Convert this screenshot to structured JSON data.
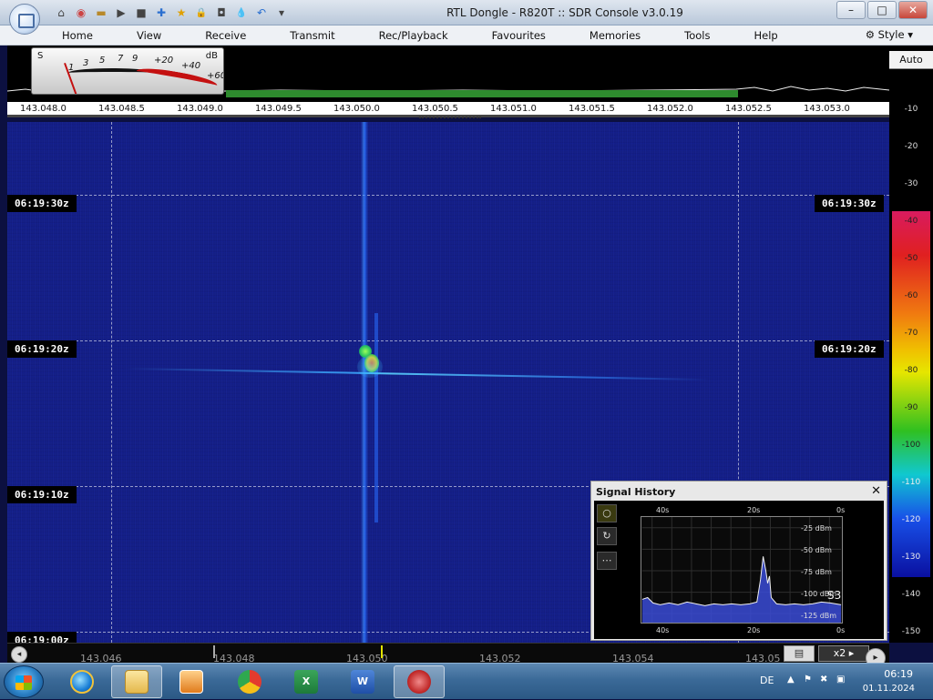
{
  "window": {
    "title": "RTL Dongle - R820T :: SDR Console v3.0.19",
    "minimize_label": "–",
    "maximize_label": "□",
    "close_label": "✕"
  },
  "quick_access": {
    "icons": [
      "home-icon",
      "lifebuoy-icon",
      "folder-icon",
      "play-icon",
      "stop-icon",
      "add-icon",
      "star-icon",
      "lock-icon",
      "camera-icon",
      "drop-icon",
      "undo-icon",
      "dropdown-icon"
    ],
    "glyphs": [
      "⌂",
      "◉",
      "▬",
      "▶",
      "■",
      "✚",
      "★",
      "🔒",
      "◘",
      "💧",
      "↶",
      "▾"
    ]
  },
  "menu": {
    "items": [
      "Home",
      "View",
      "Receive",
      "Transmit",
      "Rec/Playback",
      "Favourites",
      "Memories",
      "Tools",
      "Help"
    ],
    "style_label": "Style",
    "style_arrow": "▾"
  },
  "s_meter": {
    "s_label": "S",
    "db_label": "dB",
    "scale_labels": [
      "1",
      "3",
      "5",
      "7",
      "9",
      "+20",
      "+40",
      "+60"
    ],
    "reading_s": 1
  },
  "frequency_scale": {
    "ticks": [
      "143.048.0",
      "143.048.5",
      "143.049.0",
      "143.049.5",
      "143.050.0",
      "143.050.5",
      "143.051.0",
      "143.051.5",
      "143.052.0",
      "143.052.5",
      "143.053.0"
    ]
  },
  "db_scale": {
    "auto_label": "Auto",
    "ticks": [
      "-10",
      "-20",
      "-30",
      "-40",
      "-50",
      "-60",
      "-70",
      "-80",
      "-90",
      "-100",
      "-110",
      "-120",
      "-130",
      "-140",
      "-150"
    ]
  },
  "waterfall": {
    "time_labels_left": [
      "06:19:30z",
      "06:19:20z",
      "06:19:10z",
      "06:19:00z"
    ],
    "time_labels_right": [
      "06:19:30z",
      "06:19:20z"
    ]
  },
  "bottom_bar": {
    "freq_labels": [
      "143.046",
      "143.048",
      "143.050",
      "143.052",
      "143.054",
      "143.05"
    ],
    "zoom_label": "x2",
    "zoom_arrow": "▸",
    "left_btn_glyph": "◂",
    "right_btn_glyph": "▸",
    "speaker_glyph": "▤"
  },
  "signal_history": {
    "title": "Signal History",
    "close_label": "✕",
    "tools": [
      "○",
      "↻",
      "⋯"
    ],
    "x_labels_top": [
      "40s",
      "20s",
      "0s"
    ],
    "x_labels_bottom": [
      "40s",
      "20s",
      "0s"
    ],
    "y_labels": [
      "-25 dBm",
      "-50 dBm",
      "-75 dBm",
      "-100 dBm",
      "-125 dBm"
    ],
    "s_reading": "S3",
    "accent_color": "#3a4bd6"
  },
  "taskbar": {
    "apps": [
      "internet-explorer",
      "file-explorer",
      "media-player",
      "chrome",
      "excel",
      "word",
      "sdr-console"
    ],
    "lang": "DE",
    "time": "06:19",
    "date": "01.11.2024"
  }
}
